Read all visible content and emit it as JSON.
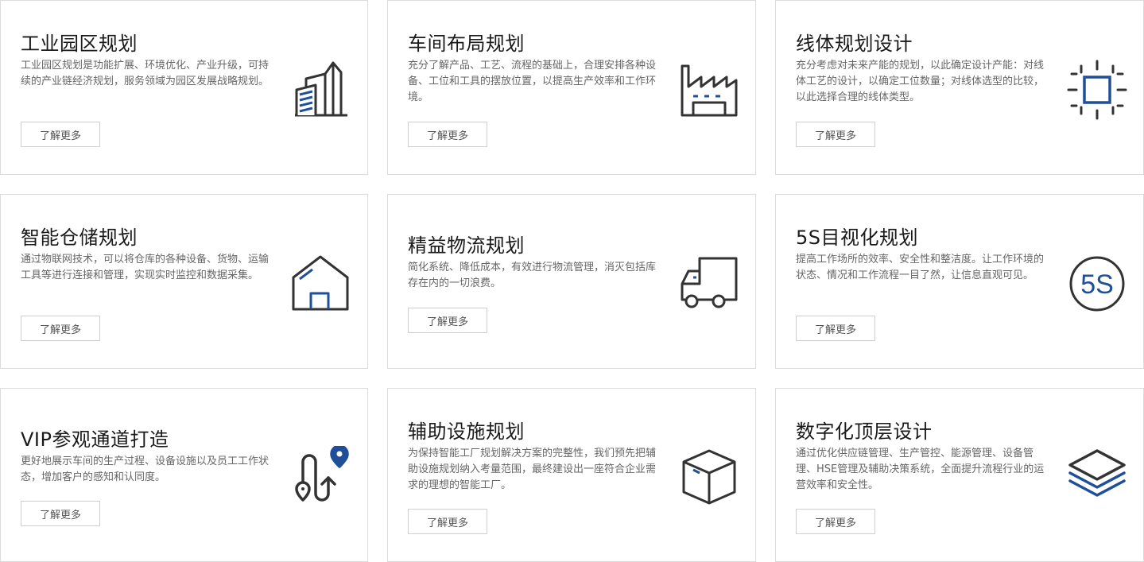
{
  "colors": {
    "icon_dark": "#333333",
    "icon_accent": "#1f4f99",
    "border": "#dcdcdc",
    "text_desc": "#666666"
  },
  "cards": [
    {
      "title": "工业园区规划",
      "desc": "工业园区规划是功能扩展、环境优化、产业升级，可持续的产业链经济规划，服务领域为园区发展战略规划。",
      "button": "了解更多",
      "icon": "buildings-icon"
    },
    {
      "title": "车间布局规划",
      "desc": "充分了解产品、工艺、流程的基础上，合理安排各种设备、工位和工具的摆放位置，以提高生产效率和工作环境。",
      "button": "了解更多",
      "icon": "factory-icon"
    },
    {
      "title": "线体规划设计",
      "desc": "充分考虑对未来产能的规划，以此确定设计产能：对线体工艺的设计，以确定工位数量；对线体选型的比较，以此选择合理的线体类型。",
      "button": "了解更多",
      "icon": "chip-icon"
    },
    {
      "title": "智能仓储规划",
      "desc": "通过物联网技术，可以将仓库的各种设备、货物、运输工具等进行连接和管理，实现实时监控和数据采集。",
      "button": "了解更多",
      "icon": "warehouse-icon"
    },
    {
      "title": "精益物流规划",
      "desc": "简化系统、降低成本，有效进行物流管理，消灭包括库存在内的一切浪费。",
      "button": "了解更多",
      "icon": "truck-icon"
    },
    {
      "title": "5S目视化规划",
      "desc": "提高工作场所的效率、安全性和整洁度。让工作环境的状态、情况和工作流程一目了然，让信息直观可见。",
      "button": "了解更多",
      "icon": "5s-badge-icon",
      "icon_text": "5S"
    },
    {
      "title": "VIP参观通道打造",
      "desc": "更好地展示车间的生产过程、设备设施以及员工工作状态，增加客户的感知和认同度。",
      "button": "了解更多",
      "icon": "route-pin-icon"
    },
    {
      "title": "辅助设施规划",
      "desc": "为保持智能工厂规划解决方案的完整性，我们预先把辅助设施规划纳入考量范围，最终建设出一座符合企业需求的理想的智能工厂。",
      "button": "了解更多",
      "icon": "box-icon"
    },
    {
      "title": "数字化顶层设计",
      "desc": "通过优化供应链管理、生产管控、能源管理、设备管理、HSE管理及辅助决策系统，全面提升流程行业的运营效率和安全性。",
      "button": "了解更多",
      "icon": "layers-icon"
    }
  ]
}
